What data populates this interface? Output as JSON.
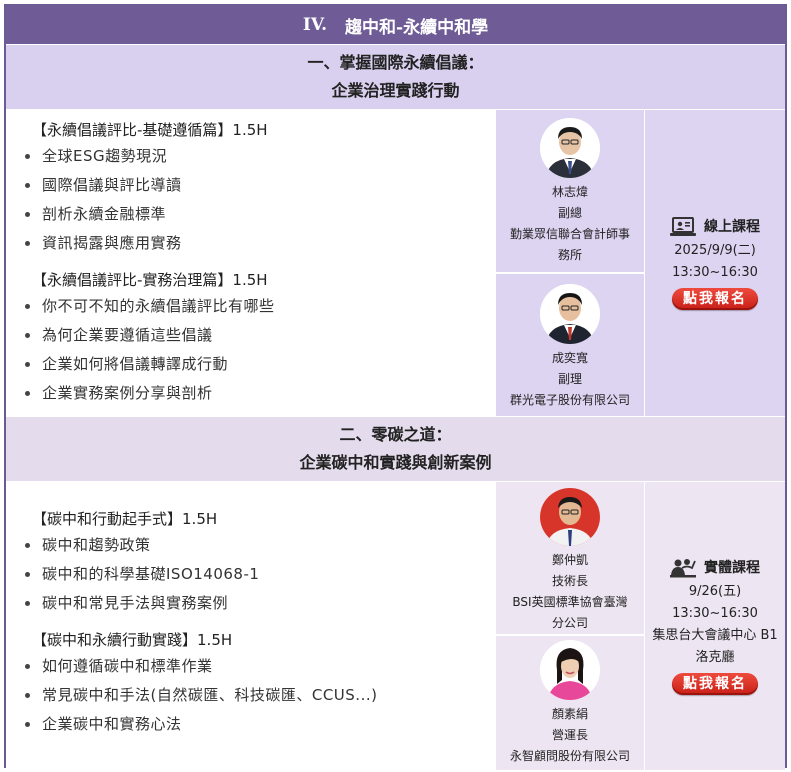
{
  "header": {
    "num": "IV.",
    "title": "趨中和-永續中和學"
  },
  "section1": {
    "heading_line1": "一、掌握國際永續倡議：",
    "heading_line2": "企業治理實踐行動",
    "courses": [
      {
        "title": "【永續倡議評比-基礎遵循篇】1.5H",
        "bullets": [
          "全球ESG趨勢現況",
          "國際倡議與評比導讀",
          "剖析永續金融標準",
          "資訊揭露與應用實務"
        ]
      },
      {
        "title": "【永續倡議評比-實務治理篇】1.5H",
        "bullets": [
          "你不可不知的永續倡議評比有哪些",
          "為何企業要遵循這些倡議",
          "企業如何將倡議轉譯成行動",
          "企業實務案例分享與剖析"
        ]
      }
    ],
    "speakers": [
      {
        "name": "林志煒",
        "role": "副總",
        "org_line1": "勤業眾信聯合會計師事",
        "org_line2": "務所"
      },
      {
        "name": "成奕寬",
        "role": "副理",
        "org_line1": "群光電子股份有限公司",
        "org_line2": ""
      }
    ],
    "session": {
      "mode": "線上課程",
      "date": "2025/9/9(二)",
      "time": "13:30~16:30",
      "register": "點我報名"
    }
  },
  "section2": {
    "heading_line1": "二、零碳之道：",
    "heading_line2": "企業碳中和實踐與創新案例",
    "courses": [
      {
        "title": "【碳中和行動起手式】1.5H",
        "bullets": [
          "碳中和趨勢政策",
          "碳中和的科學基礎ISO14068-1",
          "碳中和常見手法與實務案例"
        ]
      },
      {
        "title": "【碳中和永續行動實踐】1.5H",
        "bullets": [
          "如何遵循碳中和標準作業",
          "常見碳中和手法(自然碳匯、科技碳匯、CCUS...)",
          "企業碳中和實務心法"
        ]
      }
    ],
    "speakers": [
      {
        "name": "鄭仲凱",
        "role": "技術長",
        "org_line1": "BSI英國標準協會臺灣",
        "org_line2": "分公司"
      },
      {
        "name": "顏素絹",
        "role": "營運長",
        "org_line1": "永智顧問股份有限公司",
        "org_line2": ""
      }
    ],
    "session": {
      "mode": "實體課程",
      "date": "9/26(五)",
      "time": "13:30~16:30",
      "venue_line1": "集思台大會議中心 B1",
      "venue_line2": "洛克廳",
      "register": "點我報名"
    }
  },
  "icons": {
    "online": "laptop-video-icon",
    "offline": "people-audience-icon"
  },
  "colors": {
    "header_bg": "#6f5c96",
    "section_bg": "#d9d0ef",
    "register_btn": "#d9281d"
  }
}
